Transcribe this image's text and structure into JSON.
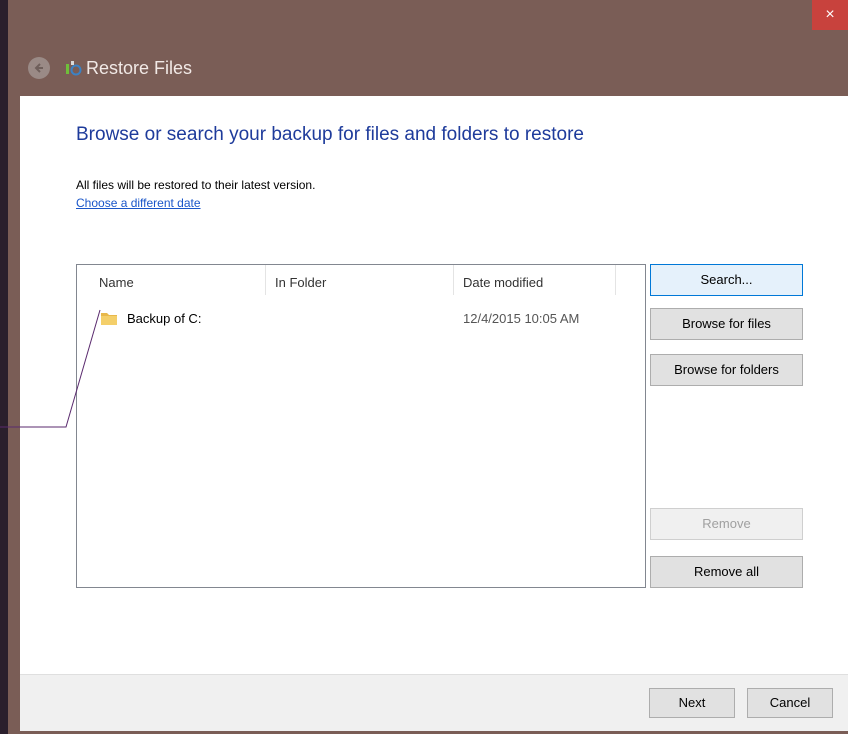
{
  "window": {
    "title": "Restore Files",
    "close_glyph": "×"
  },
  "content": {
    "heading": "Browse or search your backup for files and folders to restore",
    "info": "All files will be restored to their latest version.",
    "choose_date_link": "Choose a different date"
  },
  "list": {
    "columns": [
      "Name",
      "In Folder",
      "Date modified"
    ],
    "rows": [
      {
        "name": "Backup of C:",
        "in_folder": "",
        "date_modified": "12/4/2015 10:05 AM",
        "icon": "folder-icon"
      }
    ]
  },
  "buttons": {
    "search": "Search...",
    "browse_files": "Browse for files",
    "browse_folders": "Browse for folders",
    "remove": "Remove",
    "remove_all": "Remove all"
  },
  "footer": {
    "next": "Next",
    "cancel": "Cancel"
  },
  "colors": {
    "title_bar": "#7a5d56",
    "heading": "#1e3b9b",
    "link": "#1a56c9",
    "close_button": "#c8423d"
  }
}
